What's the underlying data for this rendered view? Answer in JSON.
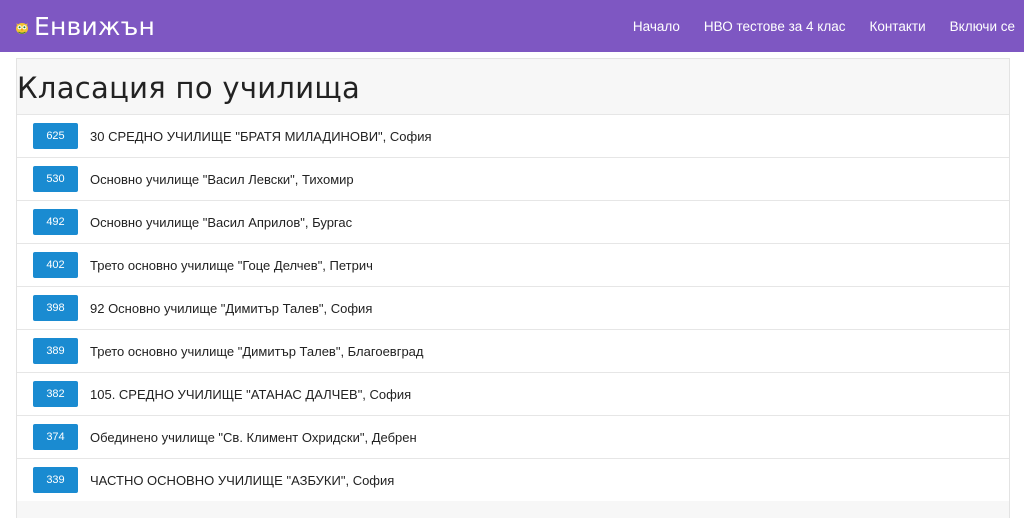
{
  "navbar": {
    "brand_icon": "owl-logo-icon",
    "brand": "Енвижън",
    "links": [
      {
        "label": "Начало"
      },
      {
        "label": "НВО тестове за 4 клас"
      },
      {
        "label": "Контакти"
      },
      {
        "label": "Включи се"
      }
    ],
    "colors": {
      "background": "#7e57c2",
      "text": "#ffffff"
    }
  },
  "main": {
    "title": "Класация по училища",
    "badge_color": "#1a8bd1",
    "schools": [
      {
        "score": "625",
        "name": "30 СРЕДНО УЧИЛИЩЕ \"БРАТЯ МИЛАДИНОВИ\", София"
      },
      {
        "score": "530",
        "name": "Основно училище \"Васил Левски\", Тихомир"
      },
      {
        "score": "492",
        "name": "Основно училище \"Васил Априлов\", Бургас"
      },
      {
        "score": "402",
        "name": "Трето основно училище \"Гоце Делчев\", Петрич"
      },
      {
        "score": "398",
        "name": "92 Основно училище \"Димитър Талев\", София"
      },
      {
        "score": "389",
        "name": "Трето основно училище \"Димитър Талев\", Благоевград"
      },
      {
        "score": "382",
        "name": "105. СРЕДНО УЧИЛИЩЕ \"АТАНАС ДАЛЧЕВ\", София"
      },
      {
        "score": "374",
        "name": "Обединено училище \"Св. Климент Охридски\", Дебрен"
      },
      {
        "score": "339",
        "name": "ЧАСТНО ОСНОВНО УЧИЛИЩЕ \"АЗБУКИ\", София"
      }
    ]
  }
}
